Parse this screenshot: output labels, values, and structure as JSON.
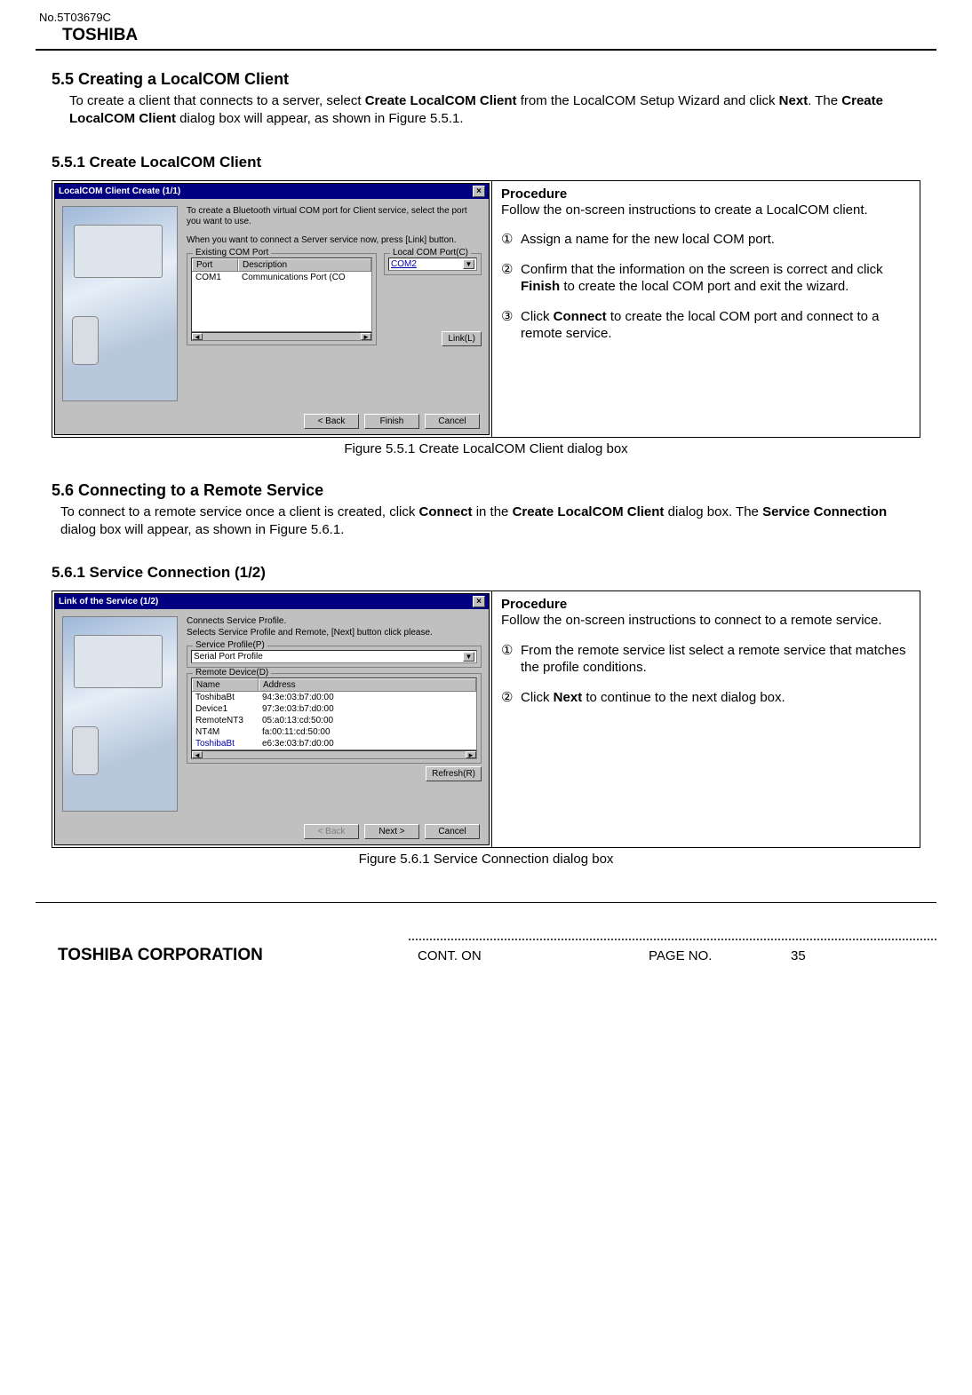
{
  "header": {
    "doc_no": "No.5T03679C",
    "brand": "TOSHIBA"
  },
  "s55": {
    "heading": "5.5 Creating a LocalCOM Client",
    "intro_pre": "To create a client that connects to a server, select ",
    "intro_b1": "Create LocalCOM Client",
    "intro_mid1": " from the LocalCOM Setup Wizard and click ",
    "intro_b2": "Next",
    "intro_mid2": ". The ",
    "intro_b3": "Create LocalCOM Client",
    "intro_post": " dialog box will appear, as shown in Figure 5.5.1."
  },
  "s551": {
    "heading": "5.5.1 Create LocalCOM Client",
    "dlg": {
      "title": "LocalCOM Client Create (1/1)",
      "line1": "To create a Bluetooth virtual COM port for Client service, select the port you want to use.",
      "line2": "When you want to connect a Server service now, press [Link] button.",
      "group_existing": "Existing COM Port",
      "col_port": "Port",
      "col_desc": "Description",
      "row_port": "COM1",
      "row_desc": "Communications Port (CO",
      "group_local": "Local COM Port(C)",
      "local_value": "COM2",
      "btn_link": "Link(L)",
      "btn_back": "< Back",
      "btn_finish": "Finish",
      "btn_cancel": "Cancel"
    },
    "proc": {
      "title": "Procedure",
      "intro": "Follow the on-screen instructions to create a LocalCOM client.",
      "m1": "①",
      "s1": "Assign a name for the new local COM port.",
      "m2": "②",
      "s2a": "Confirm that the information on the screen is correct and click ",
      "s2b": "Finish",
      "s2c": " to create the local COM port and exit the wizard.",
      "m3": "③",
      "s3a": "Click ",
      "s3b": "Connect",
      "s3c": " to create the local COM port and connect to a remote service."
    },
    "caption": "Figure 5.5.1 Create LocalCOM Client dialog box"
  },
  "s56": {
    "heading": "5.6 Connecting to a Remote Service",
    "intro_pre": "To connect to a remote service once a client is created, click ",
    "intro_b1": "Connect",
    "intro_mid1": " in the ",
    "intro_b2": "Create LocalCOM Client",
    "intro_mid2": " dialog box. The ",
    "intro_b3": "Service Connection",
    "intro_post": " dialog box will appear, as shown in Figure 5.6.1."
  },
  "s561": {
    "heading": "5.6.1 Service Connection (1/2)",
    "dlg": {
      "title": "Link of the Service (1/2)",
      "line1": "Connects Service Profile.",
      "line2": "Selects Service Profile and Remote, [Next] button click please.",
      "group_profile": "Service Profile(P)",
      "profile_value": "Serial Port Profile",
      "group_remote": "Remote Device(D)",
      "col_name": "Name",
      "col_addr": "Address",
      "rows": [
        {
          "name": "ToshibaBt",
          "addr": "94:3e:03:b7:d0:00"
        },
        {
          "name": "Device1",
          "addr": "97:3e:03:b7:d0:00"
        },
        {
          "name": "RemoteNT3",
          "addr": "05:a0:13:cd:50:00"
        },
        {
          "name": "NT4M",
          "addr": "fa:00:11:cd:50:00"
        },
        {
          "name": "ToshibaBt",
          "addr": "e6:3e:03:b7:d0:00"
        }
      ],
      "btn_refresh": "Refresh(R)",
      "btn_back": "< Back",
      "btn_next": "Next >",
      "btn_cancel": "Cancel"
    },
    "proc": {
      "title": "Procedure",
      "intro": "Follow the on-screen instructions to connect to a remote service.",
      "m1": "①",
      "s1": "From the remote service list select a remote service that matches the profile conditions.",
      "m2": "②",
      "s2a": "Click ",
      "s2b": "Next",
      "s2c": " to continue to the next dialog box."
    },
    "caption": "Figure 5.6.1 Service Connection dialog box"
  },
  "footer": {
    "company": "TOSHIBA CORPORATION",
    "cont": "CONT. ON",
    "page_label": "PAGE NO.",
    "page_no": "35"
  }
}
